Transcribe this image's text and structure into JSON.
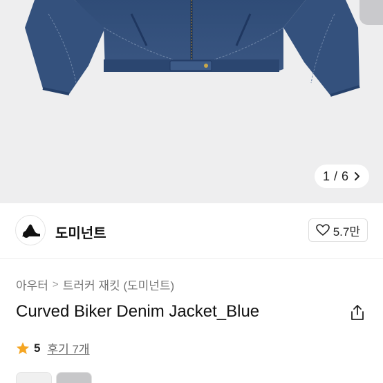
{
  "gallery": {
    "current_page": "1",
    "separator": "/",
    "total_pages": "6",
    "next_icon": "chevron-right-icon"
  },
  "brand": {
    "name": "도미넌트",
    "logo_icon": "brand-logo-icon",
    "like_icon": "heart-outline-icon",
    "like_count": "5.7만"
  },
  "breadcrumb": {
    "items": [
      "아우터",
      "트러커 재킷 (도미넌트)"
    ],
    "separator": ">"
  },
  "product": {
    "title": "Curved Biker Denim Jacket_Blue",
    "share_icon": "share-icon"
  },
  "rating": {
    "star_color": "#F5A623",
    "score": "5",
    "reviews_label": "후기 7개"
  }
}
